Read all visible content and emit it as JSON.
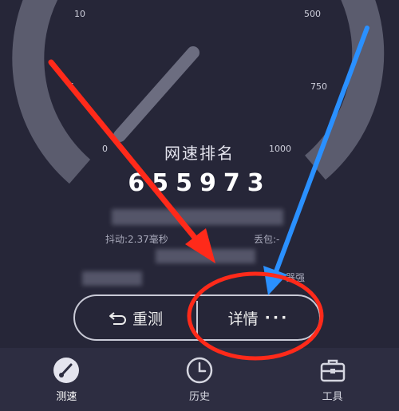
{
  "gauge": {
    "labels": [
      "0",
      "5",
      "10",
      "500",
      "750",
      "1000"
    ]
  },
  "rank": {
    "title": "网速排名",
    "value": "655973"
  },
  "stats": {
    "jitter": "抖动:2.37毫秒",
    "packet_loss": "丢包:-",
    "extra": "器强"
  },
  "buttons": {
    "retest": "重测",
    "details": "详情"
  },
  "nav": [
    {
      "label": "测速",
      "icon": "speedometer-icon",
      "active": true
    },
    {
      "label": "历史",
      "icon": "clock-icon",
      "active": false
    },
    {
      "label": "工具",
      "icon": "toolbox-icon",
      "active": false
    }
  ],
  "colors": {
    "background": "#262638",
    "gauge_track": "#5b5c6e",
    "annotation_red": "#ff2a1a",
    "annotation_blue": "#2a90ff"
  }
}
